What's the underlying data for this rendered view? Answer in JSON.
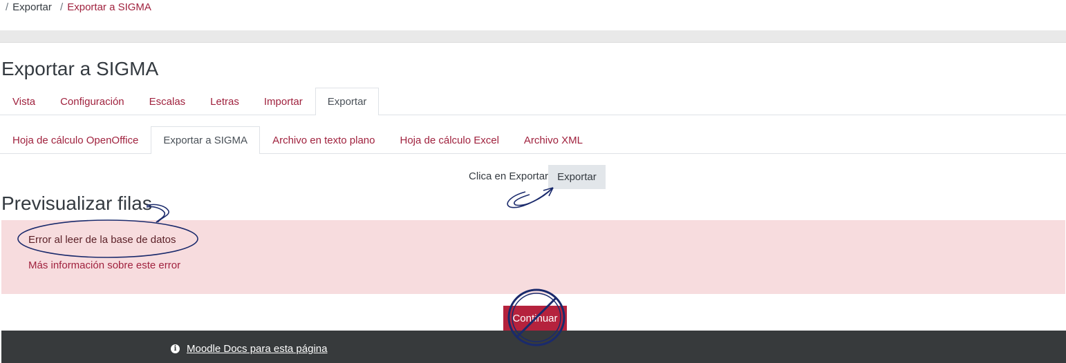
{
  "breadcrumb": [
    {
      "label": "Exportar",
      "link": false
    },
    {
      "label": "Exportar a SIGMA",
      "link": true
    }
  ],
  "page_title": "Exportar a SIGMA",
  "tabs_primary": [
    {
      "label": "Vista",
      "active": false
    },
    {
      "label": "Configuración",
      "active": false
    },
    {
      "label": "Escalas",
      "active": false
    },
    {
      "label": "Letras",
      "active": false
    },
    {
      "label": "Importar",
      "active": false
    },
    {
      "label": "Exportar",
      "active": true
    }
  ],
  "tabs_secondary": [
    {
      "label": "Hoja de cálculo OpenOffice",
      "active": false
    },
    {
      "label": "Exportar a SIGMA",
      "active": true
    },
    {
      "label": "Archivo en texto plano",
      "active": false
    },
    {
      "label": "Hoja de cálculo Excel",
      "active": false
    },
    {
      "label": "Archivo XML",
      "active": false
    }
  ],
  "export": {
    "instruction": "Clica en Exportar",
    "button_label": "Exportar"
  },
  "preview_title": "Previsualizar filas",
  "alert": {
    "message": "Error al leer de la base de datos",
    "more_info": "Más información sobre este error"
  },
  "continue_label": "Continuar",
  "footer": {
    "docs_icon": "info-icon",
    "docs_link": "Moodle Docs para esta página"
  },
  "colors": {
    "link": "#a0223e",
    "alert_bg": "#f7dcde",
    "primary_button": "#b5223d",
    "footer_bg": "#373a3c",
    "annotation": "#1a2a6c"
  }
}
